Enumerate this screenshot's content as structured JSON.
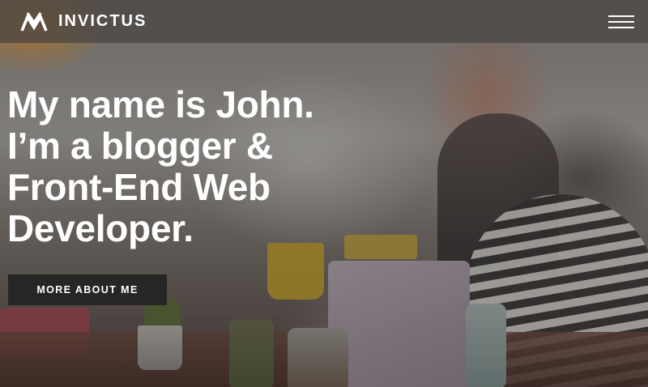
{
  "header": {
    "logo_icon": "invictus-mountain-logo-icon",
    "brand": "INVICTUS",
    "menu_icon": "hamburger-menu-icon"
  },
  "hero": {
    "title_lines": [
      "My name is John.",
      "I’m a blogger &",
      "Front-End Web",
      "Developer."
    ],
    "cta_label": "MORE ABOUT ME"
  },
  "colors": {
    "header_bg": "#464442",
    "text": "#ffffff",
    "cta_bg": "#262626"
  }
}
